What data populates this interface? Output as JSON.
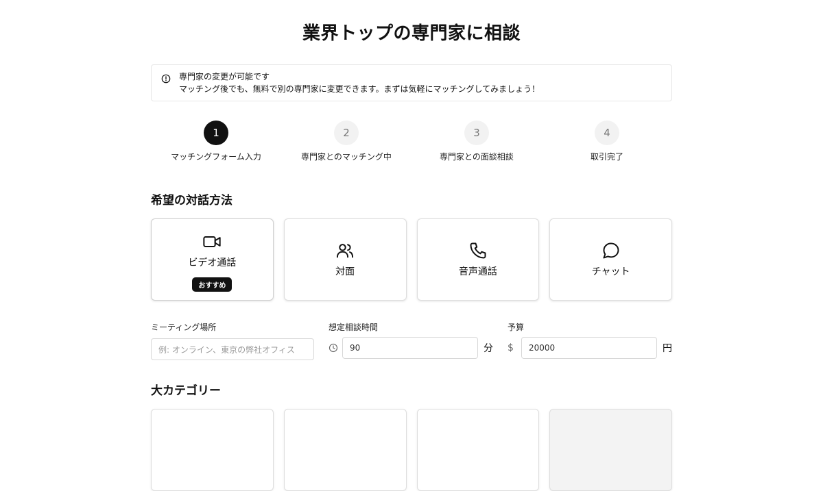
{
  "page": {
    "title": "業界トップの専門家に相談"
  },
  "notice": {
    "icon": "info-circle-icon",
    "line1": "専門家の変更が可能です",
    "line2": "マッチング後でも、無料で別の専門家に変更できます。まずは気軽にマッチングしてみましょう！"
  },
  "steps": [
    {
      "num": "1",
      "label": "マッチングフォーム入力"
    },
    {
      "num": "2",
      "label": "専門家とのマッチング中"
    },
    {
      "num": "3",
      "label": "専門家との面談相談"
    },
    {
      "num": "4",
      "label": "取引完了"
    }
  ],
  "method": {
    "title": "希望の対話方法",
    "options": [
      {
        "label": "ビデオ通話",
        "icon": "video-icon",
        "badge": "おすすめ"
      },
      {
        "label": "対面",
        "icon": "users-icon"
      },
      {
        "label": "音声通話",
        "icon": "phone-icon"
      },
      {
        "label": "チャット",
        "icon": "chat-bubble-icon"
      }
    ]
  },
  "fields": {
    "location": {
      "label": "ミーティング場所",
      "placeholder": "例: オンライン、東京の弊社オフィス"
    },
    "duration": {
      "label": "想定相談時間",
      "value": "90",
      "unit": "分",
      "icon": "clock-icon"
    },
    "budget": {
      "label": "予算",
      "value": "20000",
      "unit": "円",
      "prefix": "$"
    }
  },
  "category": {
    "title": "大カテゴリー"
  },
  "colors": {
    "accent": "#111111",
    "border": "#dddddd",
    "muted_bg": "#f2f2f2"
  }
}
